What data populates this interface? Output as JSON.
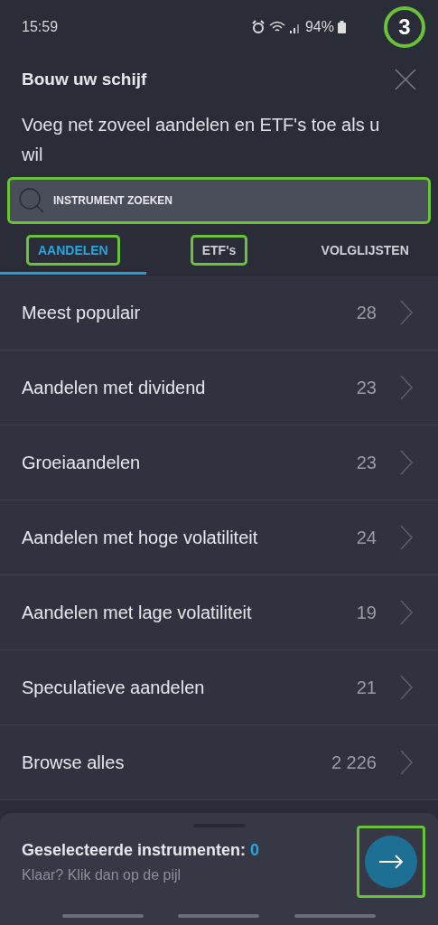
{
  "status_bar": {
    "time": "15:59",
    "battery": "94%"
  },
  "step_badge": "3",
  "header": {
    "title": "Bouw uw schijf",
    "subtitle": "Voeg net zoveel aandelen en ETF's toe als u wil"
  },
  "search": {
    "placeholder": "INSTRUMENT ZOEKEN",
    "highlighted": true
  },
  "tabs": [
    {
      "label": "AANDELEN",
      "selected": true,
      "highlighted": true
    },
    {
      "label": "ETF's",
      "selected": false,
      "highlighted": true
    },
    {
      "label": "VOLGLIJSTEN",
      "selected": false,
      "highlighted": false
    }
  ],
  "categories": [
    {
      "name": "Meest populair",
      "count": "28"
    },
    {
      "name": "Aandelen met dividend",
      "count": "23"
    },
    {
      "name": "Groeiaandelen",
      "count": "23"
    },
    {
      "name": "Aandelen met hoge volatiliteit",
      "count": "24"
    },
    {
      "name": "Aandelen met lage volatiliteit",
      "count": "19"
    },
    {
      "name": "Speculatieve aandelen",
      "count": "21"
    },
    {
      "name": "Browse alles",
      "count": "2 226"
    }
  ],
  "footer": {
    "label": "Geselecteerde instrumenten:",
    "count": "0",
    "hint": "Klaar? Klik dan op de pijl",
    "next_highlighted": true
  }
}
